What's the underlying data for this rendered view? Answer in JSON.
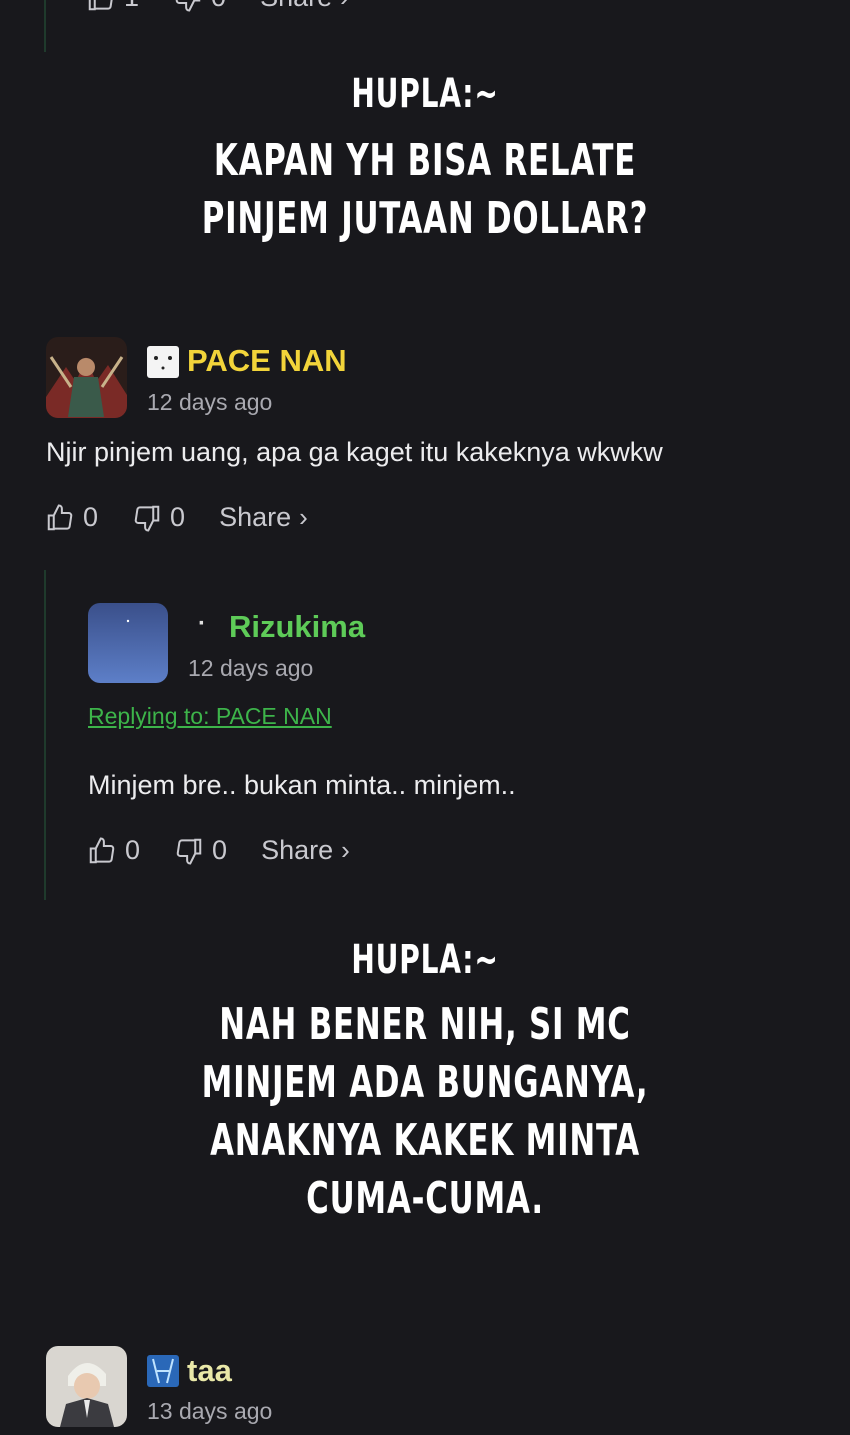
{
  "top_actions": {
    "like_count": "1",
    "dislike_count": "0",
    "share_label": "Share",
    "share_chevron": "›"
  },
  "overlay_1": {
    "label": "HUPLA:~",
    "lines": [
      "KAPAN YH BISA RELATE",
      "PINJEM JUTAAN DOLLAR?"
    ]
  },
  "comment_1": {
    "username": "PACE NAN",
    "username_color": "#f2d43a",
    "time": "12 days ago",
    "text": "Njir pinjem uang, apa ga kaget itu kakeknya wkwkw",
    "like_count": "0",
    "dislike_count": "0",
    "share_label": "Share",
    "share_chevron": "›"
  },
  "reply_1": {
    "username_prefix": "·",
    "username": "Rizukima",
    "username_color": "#5ecb58",
    "time": "12 days ago",
    "replying_to": "Replying to: PACE NAN",
    "text": "Minjem bre.. bukan minta.. minjem..",
    "like_count": "0",
    "dislike_count": "0",
    "share_label": "Share",
    "share_chevron": "›"
  },
  "overlay_2": {
    "label": "HUPLA:~",
    "lines": [
      "NAH BENER NIH, SI MC",
      "MINJEM ADA BUNGANYA,",
      "ANAKNYA KAKEK MINTA",
      "CUMA-CUMA."
    ]
  },
  "comment_2": {
    "username": "taa",
    "username_color": "#e9e8a8",
    "time": "13 days ago"
  },
  "icons": [
    "thumbs-up-icon",
    "thumbs-down-icon",
    "chevron-right-icon"
  ]
}
